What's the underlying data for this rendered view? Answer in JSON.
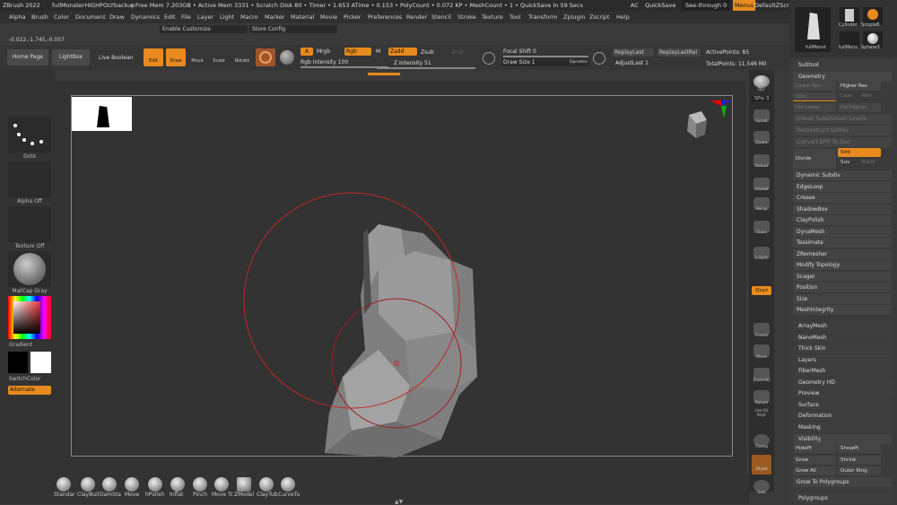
{
  "title": {
    "app": "ZBrush 2022",
    "project": "fullMonsterHIGHPOLYbackup",
    "stats": "• Free Mem 7.203GB • Active Mem 3331 • Scratch Disk 80 • Timer • 1.653 ATime • 0.153 • PolyCount • 0.072 KP • MeshCount • 1 • QuickSave In 59 Secs",
    "ac": "AC",
    "quicksave": "QuickSave",
    "seethrough": "See-through 0",
    "menus": "Menus",
    "script": "DefaultZScript"
  },
  "menu": [
    "Alpha",
    "Brush",
    "Color",
    "Document",
    "Draw",
    "Dynamics",
    "Edit",
    "File",
    "Layer",
    "Light",
    "Macro",
    "Marker",
    "Material",
    "Movie",
    "Picker",
    "Preferences",
    "Render",
    "Stencil",
    "Stroke",
    "Texture",
    "Tool",
    "Transform",
    "Zplugin",
    "Zscript",
    "Help"
  ],
  "sub": {
    "enable_customize": "Enable Customize",
    "store_config": "Store Config",
    "coords": "-0.022,-1.745,-0.057"
  },
  "toolbar": {
    "home": "Home Page",
    "lightbox": "LightBox",
    "liveboolean": "Live Boolean",
    "edit": "Edit",
    "draw": "Draw",
    "move": "Move",
    "scale": "Scale",
    "rotate": "Rotate",
    "a": "A",
    "mrgb": "Mrgb",
    "rgb": "Rgb",
    "m": "M",
    "zadd": "Zadd",
    "zsub": "Zsub",
    "zcut": "Zcut",
    "rgb_int": "Rgb Intensity 100",
    "z_int": "Z Intensity 51",
    "focal": "Focal Shift 0",
    "drawsize": "Draw Size 1",
    "dynamic": "Dynamic",
    "replaylast": "ReplayLast",
    "replaylastrel": "ReplayLastRel",
    "adjustlast": "AdjustLast 1",
    "activepoints": "ActivePoints: 85",
    "totalpoints": "TotalPoints: 11.546 Mil"
  },
  "left": {
    "dots": "Dots",
    "alpha": "Alpha Off",
    "texture": "Texture Off",
    "matcap": "MatCap Gray",
    "gradient": "Gradient",
    "switchcolor": "SwitchColor",
    "alternate": "Alternate"
  },
  "rshelf": [
    "Bpr",
    "SPix 3",
    "Scroll",
    "Zoom",
    "Actual",
    "AAHalf",
    "Persp",
    "Floor",
    "L.Sym",
    "Qxyz",
    "Frame",
    "Move",
    "Zoom3D",
    "Rotate",
    "Line Fill PolyF",
    "Transp",
    "Ghost",
    "Solo"
  ],
  "tools": {
    "t1": "fullMonst",
    "t2": "Cylinder",
    "t3": "SimpleB",
    "t4": "fullMons",
    "t5": "Sphere3"
  },
  "panel": {
    "subtool": "Subtool",
    "geometry": "Geometry",
    "lowerres": "Lower Res",
    "higherres": "Higher Res",
    "sdiv": "SDiv",
    "cage": "Cage",
    "rstr": "Rstr",
    "dellower": "Del Lower",
    "delhigher": "Del Higher",
    "freeze": "Freeze SubDivision Levels",
    "reconstruct": "Reconstruct Subdiv",
    "convert": "Convert BPR To Geo",
    "divide": "Divide",
    "smt": "Smt",
    "suv": "Suv",
    "reuv": "ReUV",
    "items": [
      "Dynamic Subdiv",
      "EdgeLoop",
      "Crease",
      "ShadowBox",
      "ClayPolish",
      "DynaMesh",
      "Tessimate",
      "ZRemesher",
      "Modify Topology",
      "Scager",
      "Position",
      "Size",
      "MeshIntegrity"
    ],
    "items2": [
      "ArrayMesh",
      "NanoMesh",
      "Thick Skin",
      "Layers",
      "FiberMesh",
      "Geometry HD",
      "Preview",
      "Surface",
      "Deformation",
      "Masking"
    ],
    "visibility": "Visibility",
    "hidept": "HidePt",
    "showpt": "ShowPt",
    "grow": "Grow",
    "shrink": "Shrink",
    "growall": "Grow All",
    "outerring": "Outer Ring",
    "growpoly": "Grow To Polygroups",
    "polygroups": "Polygroups"
  },
  "brushes": [
    "Standar",
    "ClayBuil",
    "DamSta",
    "Move",
    "hPolish",
    "Inflat",
    "Pinch",
    "Move Tc",
    "ZModel",
    "ClayTub",
    "CurveTu"
  ],
  "colors": {
    "accent": "#e88a1e",
    "brush_circle": "#c0282a"
  }
}
